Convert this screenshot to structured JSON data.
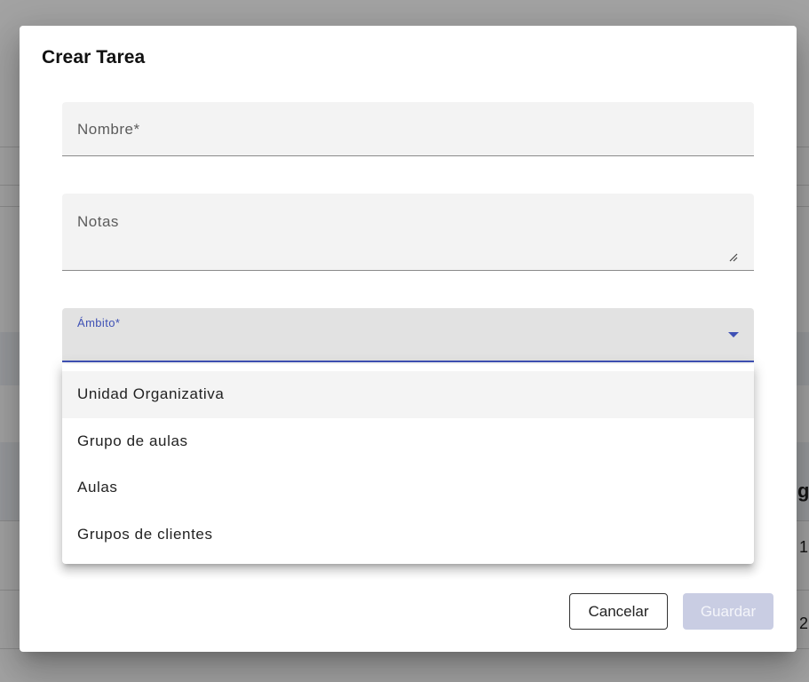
{
  "background": {
    "partial_text_1": "g",
    "partial_text_2": "1",
    "partial_text_3": "2"
  },
  "dialog": {
    "title": "Crear Tarea",
    "fields": {
      "name_label": "Nombre*",
      "notes_label": "Notas",
      "scope_label": "Ámbito*"
    },
    "dropdown": {
      "options": [
        "Unidad Organizativa",
        "Grupo de aulas",
        "Aulas",
        "Grupos de clientes"
      ]
    },
    "actions": {
      "cancel_label": "Cancelar",
      "save_label": "Guardar"
    }
  },
  "colors": {
    "accent": "#3f51b5",
    "save_disabled_bg": "#c9cde3"
  }
}
